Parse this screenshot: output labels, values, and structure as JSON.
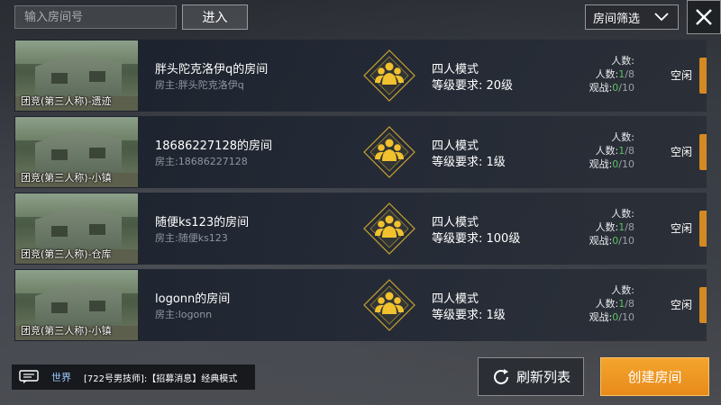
{
  "topbar": {
    "search_placeholder": "输入房间号",
    "enter_label": "进入",
    "filter_label": "房间筛选"
  },
  "rooms": [
    {
      "map_label": "团竞(第三人称)-遗迹",
      "name": "胖头陀克洛伊q的房间",
      "host": "房主:胖头陀克洛伊q",
      "mode": "四人模式",
      "level": "等级要求: 20级",
      "players_label": "人数:",
      "count_label": "人数:",
      "count_current": "1",
      "count_max": "/8",
      "spectator_label": "观战:",
      "spectator_current": "0",
      "spectator_max": "/10",
      "status": "空闲"
    },
    {
      "map_label": "团竞(第三人称)-小镇",
      "name": "18686227128的房间",
      "host": "房主:18686227128",
      "mode": "四人模式",
      "level": "等级要求: 1级",
      "players_label": "人数:",
      "count_label": "人数:",
      "count_current": "1",
      "count_max": "/8",
      "spectator_label": "观战:",
      "spectator_current": "0",
      "spectator_max": "/10",
      "status": "空闲"
    },
    {
      "map_label": "团竞(第三人称)-仓库",
      "name": "随便ks123的房间",
      "host": "房主:随便ks123",
      "mode": "四人模式",
      "level": "等级要求: 100级",
      "players_label": "人数:",
      "count_label": "人数:",
      "count_current": "1",
      "count_max": "/8",
      "spectator_label": "观战:",
      "spectator_current": "0",
      "spectator_max": "/10",
      "status": "空闲"
    },
    {
      "map_label": "团竞(第三人称)-小镇",
      "name": "logonn的房间",
      "host": "房主:logonn",
      "mode": "四人模式",
      "level": "等级要求: 1级",
      "players_label": "人数:",
      "count_label": "人数:",
      "count_current": "1",
      "count_max": "/8",
      "spectator_label": "观战:",
      "spectator_current": "0",
      "spectator_max": "/10",
      "status": "空闲"
    }
  ],
  "chat": {
    "icon": "chat-bubble-icon",
    "channel": "世界",
    "message": "[722号男技师]:【招募消息】经典模式"
  },
  "buttons": {
    "refresh_label": "刷新列表",
    "create_label": "创建房间"
  },
  "colors": {
    "accent_orange": "#f09a24",
    "mode_icon_gold": "#f2c22e",
    "green_count": "#59c35e"
  }
}
